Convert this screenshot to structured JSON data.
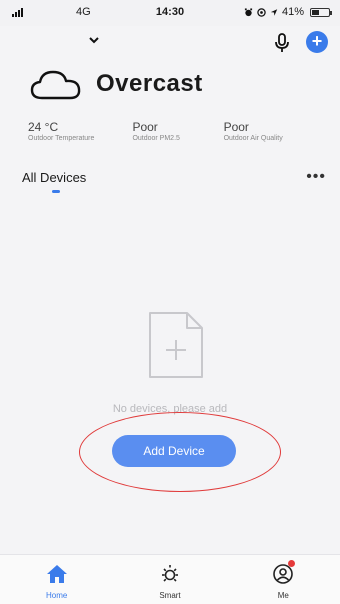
{
  "status_bar": {
    "network": "4G",
    "time": "14:30",
    "battery_text": "41%",
    "battery_level": 0.41
  },
  "topbar": {
    "home_chevron_icon": "chevron-down-icon",
    "mic_icon": "microphone-icon",
    "add_icon": "plus-circle-icon",
    "add_symbol": "+"
  },
  "weather": {
    "icon": "cloud-icon",
    "condition": "Overcast",
    "stats": [
      {
        "value": "24 °C",
        "label": "Outdoor Temperature"
      },
      {
        "value": "Poor",
        "label": "Outdoor PM2.5"
      },
      {
        "value": "Poor",
        "label": "Outdoor Air Quality"
      }
    ]
  },
  "devices": {
    "tab_label": "All Devices",
    "more_label": "•••",
    "empty_text": "No devices, please add",
    "empty_icon": "add-file-icon",
    "add_button_label": "Add Device"
  },
  "nav": {
    "items": [
      {
        "label": "Home",
        "icon": "home-icon"
      },
      {
        "label": "Smart",
        "icon": "sun-icon"
      },
      {
        "label": "Me",
        "icon": "user-icon"
      }
    ]
  },
  "colors": {
    "accent": "#3a7bea",
    "button": "#5a8ef0",
    "highlight_ring": "#e03a3a",
    "background": "#f4f4f6"
  }
}
